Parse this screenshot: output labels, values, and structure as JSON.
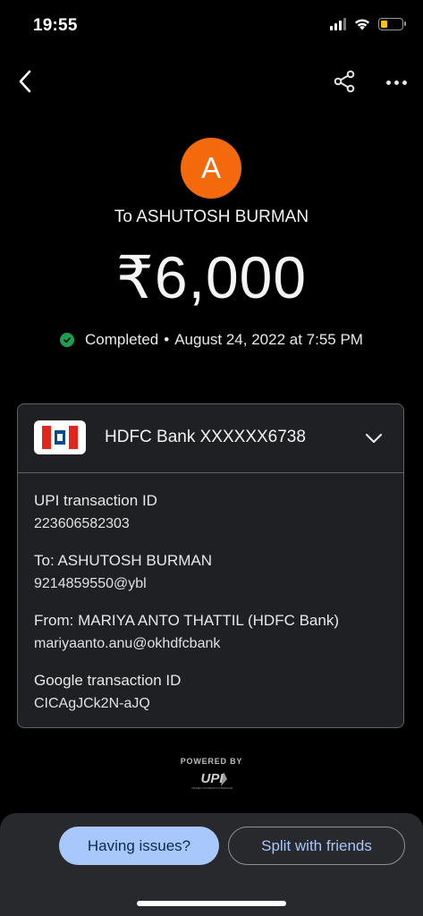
{
  "status_bar": {
    "time": "19:55",
    "battery_level": 0.3,
    "battery_color": "#f4c21a"
  },
  "toolbar": {
    "back_icon": "chevron-left-icon",
    "share_icon": "share-icon",
    "more_icon": "more-horizontal-icon"
  },
  "payee": {
    "avatar_letter": "A",
    "avatar_color": "#f5690d",
    "to_label": "To ASHUTOSH BURMAN"
  },
  "amount": "₹6,000",
  "status": {
    "text": "Completed",
    "separator": "•",
    "datetime": "August 24, 2022 at 7:55 PM",
    "color": "#1e9e4f"
  },
  "card": {
    "bank_account": "HDFC Bank XXXXXX6738",
    "details": [
      {
        "label": "UPI transaction ID",
        "value": "223606582303"
      },
      {
        "label": "To: ASHUTOSH BURMAN",
        "value": "9214859550@ybl"
      },
      {
        "label": "From: MARIYA ANTO THATTIL (HDFC Bank)",
        "value": "mariyaanto.anu@okhdfcbank"
      },
      {
        "label": "Google transaction ID",
        "value": "CICAgJCk2N-aJQ"
      }
    ]
  },
  "footer": {
    "powered_by": "POWERED BY",
    "upi_wordmark": "UPI",
    "upi_tagline": "UNIFIED PAYMENTS INTERFACE"
  },
  "actions": {
    "having_issues": "Having issues?",
    "split_with_friends": "Split with friends",
    "accent": "#a8c7fa"
  }
}
